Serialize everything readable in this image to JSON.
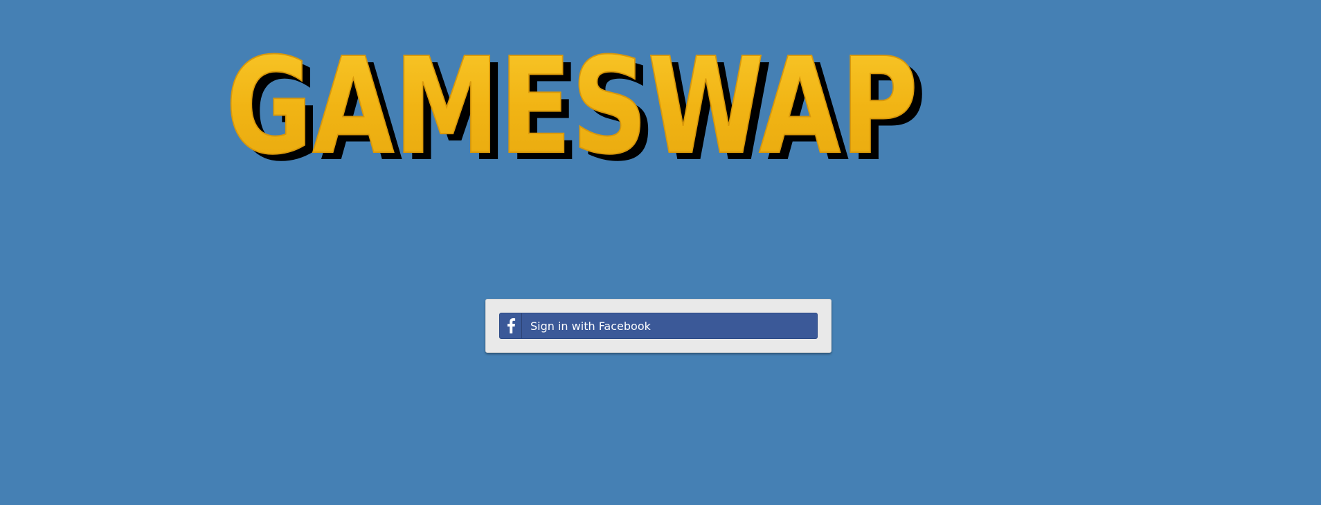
{
  "brand": {
    "logo_text": "GAMESWAP",
    "logo_fill": "#f3b81a",
    "logo_shadow": "#000000"
  },
  "login": {
    "facebook_button_label": "Sign in with Facebook",
    "facebook_icon": "facebook-f-icon"
  },
  "colors": {
    "page_background": "#4580b4",
    "card_background": "#e9e9e9",
    "facebook_blue": "#3b5998"
  }
}
